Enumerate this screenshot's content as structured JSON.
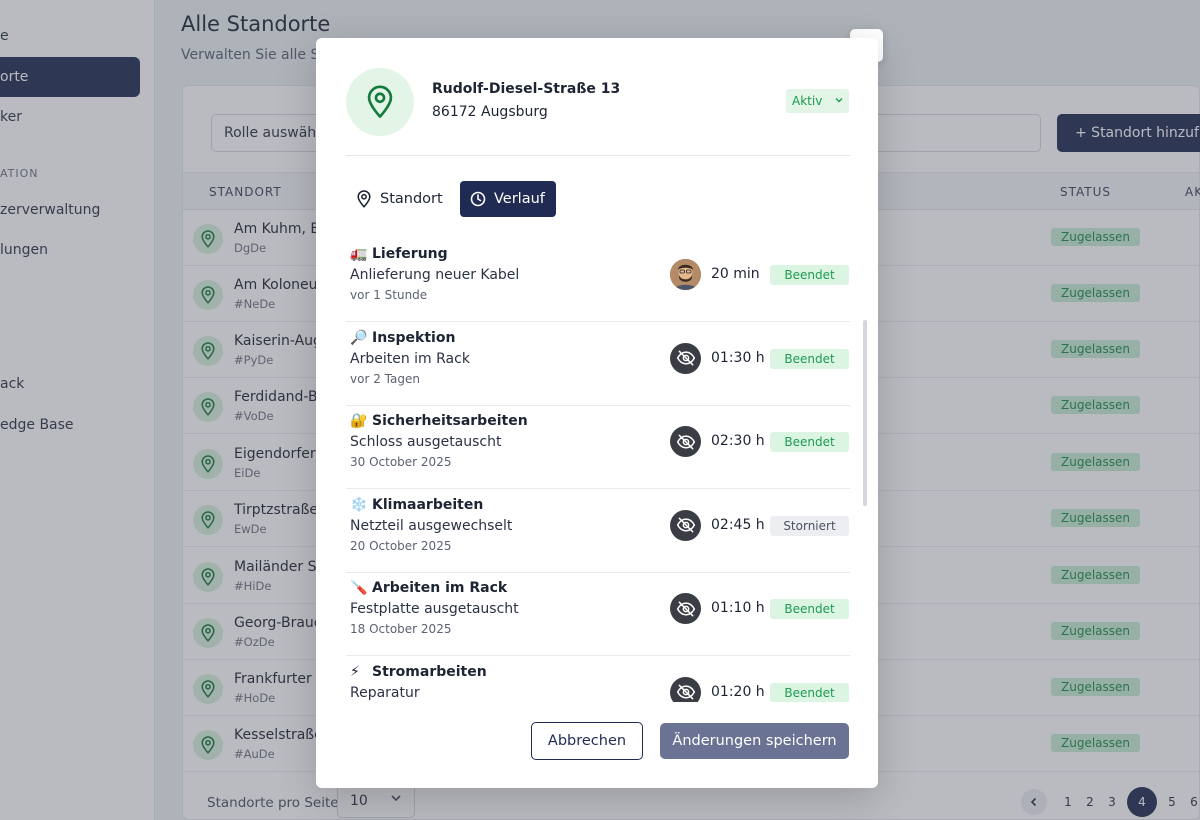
{
  "sidebar": {
    "items": [
      {
        "label": "e",
        "active": false
      },
      {
        "label": "orte",
        "active": true
      },
      {
        "label": "ker",
        "active": false
      },
      {
        "label": "zerverwaltung",
        "active": false
      },
      {
        "label": "lungen",
        "active": false
      },
      {
        "label": "ack",
        "active": false
      },
      {
        "label": "edge Base",
        "active": false
      }
    ],
    "section": "ATION"
  },
  "page": {
    "title": "Alle Standorte",
    "subtitle": "Verwalten Sie alle Sta",
    "role_placeholder": "Rolle auswähle",
    "add_button": "+ Standort hinzufü"
  },
  "table": {
    "headers": {
      "standort": "STANDORT",
      "status": "STATUS",
      "actions": "AK"
    },
    "rows": [
      {
        "name": "Am Kuhm, Bo",
        "code": "DgDe",
        "status": "Zugelassen"
      },
      {
        "name": "Am Koloneur",
        "code": "#NeDe",
        "status": "Zugelassen"
      },
      {
        "name": "Kaiserin-Aug",
        "code": "#PyDe",
        "status": "Zugelassen"
      },
      {
        "name": "Ferdidand-Br",
        "code": "#VoDe",
        "status": "Zugelassen"
      },
      {
        "name": "Eigendorfer S",
        "code": "EiDe",
        "status": "Zugelassen"
      },
      {
        "name": "Tirptzstraße",
        "code": "EwDe",
        "status": "Zugelassen"
      },
      {
        "name": "Mailänder St",
        "code": "#HiDe",
        "status": "Zugelassen"
      },
      {
        "name": "Georg-Brauc",
        "code": "#OzDe",
        "status": "Zugelassen"
      },
      {
        "name": "Frankfurter I",
        "code": "#HoDe",
        "status": "Zugelassen"
      },
      {
        "name": "Kesselstraße",
        "code": "#AuDe",
        "status": "Zugelassen"
      }
    ]
  },
  "footer": {
    "per_page_label": "Standorte pro Seite",
    "per_page_value": "10",
    "pages": [
      "1",
      "2",
      "3",
      "4",
      "5",
      "6"
    ],
    "active_page": "4"
  },
  "modal": {
    "street": "Rudolf-Diesel-Straße 13",
    "city": "86172 Augsburg",
    "status": "Aktiv",
    "tabs": {
      "standort": "Standort",
      "verlauf": "Verlauf"
    },
    "history": [
      {
        "emoji": "🚛",
        "title": "Lieferung",
        "desc": "Anlieferung neuer Kabel",
        "time": "vor 1 Stunde",
        "duration": "20 min",
        "badge": "Beendet",
        "avatar": "photo"
      },
      {
        "emoji": "🔎",
        "title": "Inspektion",
        "desc": "Arbeiten im Rack",
        "time": "vor 2 Tagen",
        "duration": "01:30 h",
        "badge": "Beendet",
        "avatar": "hidden"
      },
      {
        "emoji": "🔐",
        "title": "Sicherheitsarbeiten",
        "desc": "Schloss ausgetauscht",
        "time": "30 October 2025",
        "duration": "02:30 h",
        "badge": "Beendet",
        "avatar": "hidden"
      },
      {
        "emoji": "❄️",
        "title": "Klimaarbeiten",
        "desc": "Netzteil ausgewechselt",
        "time": "20 October 2025",
        "duration": "02:45 h",
        "badge": "Storniert",
        "avatar": "hidden"
      },
      {
        "emoji": "🪛",
        "title": "Arbeiten im Rack",
        "desc": "Festplatte ausgetauscht",
        "time": "18 October 2025",
        "duration": "01:10 h",
        "badge": "Beendet",
        "avatar": "hidden"
      },
      {
        "emoji": "⚡",
        "title": "Stromarbeiten",
        "desc": "Reparatur",
        "time": "",
        "duration": "01:20 h",
        "badge": "Beendet",
        "avatar": "hidden"
      }
    ],
    "cancel_label": "Abbrechen",
    "save_label": "Änderungen speichern"
  },
  "colors": {
    "primary": "#1f2b52",
    "success_text": "#1d9a50",
    "success_bg": "#dcf5e3"
  }
}
